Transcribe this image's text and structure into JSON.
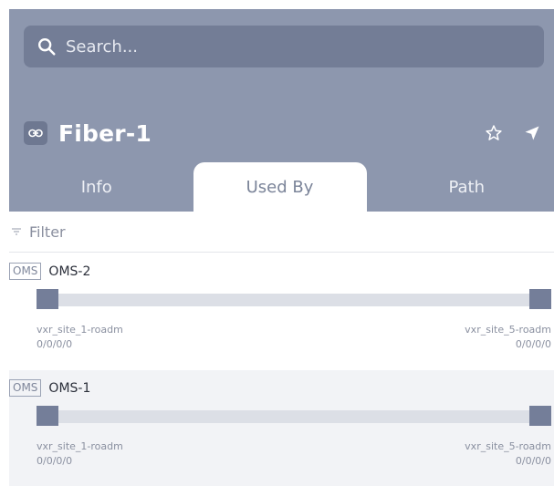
{
  "search": {
    "placeholder": "Search..."
  },
  "header": {
    "title": "Fiber-1",
    "link_icon": "link-icon",
    "actions": [
      "star-icon",
      "navigate-icon"
    ]
  },
  "tabs": [
    {
      "label": "Info",
      "active": false
    },
    {
      "label": "Used By",
      "active": true
    },
    {
      "label": "Path",
      "active": false
    }
  ],
  "filter": {
    "label": "Filter",
    "icon": "filter-icon"
  },
  "items": [
    {
      "tag": "OMS",
      "name": "OMS-2",
      "start": {
        "site": "vxr_site_1-roadm",
        "port": "0/0/0/0"
      },
      "end": {
        "site": "vxr_site_5-roadm",
        "port": "0/0/0/0"
      }
    },
    {
      "tag": "OMS",
      "name": "OMS-1",
      "start": {
        "site": "vxr_site_1-roadm",
        "port": "0/0/0/0"
      },
      "end": {
        "site": "vxr_site_5-roadm",
        "port": "0/0/0/0"
      }
    }
  ],
  "colors": {
    "header_bg": "#8d97ae",
    "search_bg": "#737d96",
    "node": "#747e99",
    "bar": "#dcdfe6",
    "alt_row": "#f2f3f6"
  }
}
